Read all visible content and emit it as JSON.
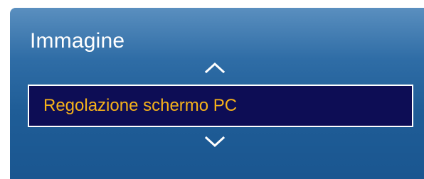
{
  "menu": {
    "title": "Immagine",
    "selected_item": {
      "label": "Regolazione schermo PC"
    },
    "icons": {
      "up": "chevron-up-icon",
      "down": "chevron-down-icon"
    }
  },
  "colors": {
    "panel_blue": "#2f6da6",
    "highlight_bg": "#0d0d55",
    "highlight_text": "#f6b21a",
    "title_text": "#ffffff"
  }
}
